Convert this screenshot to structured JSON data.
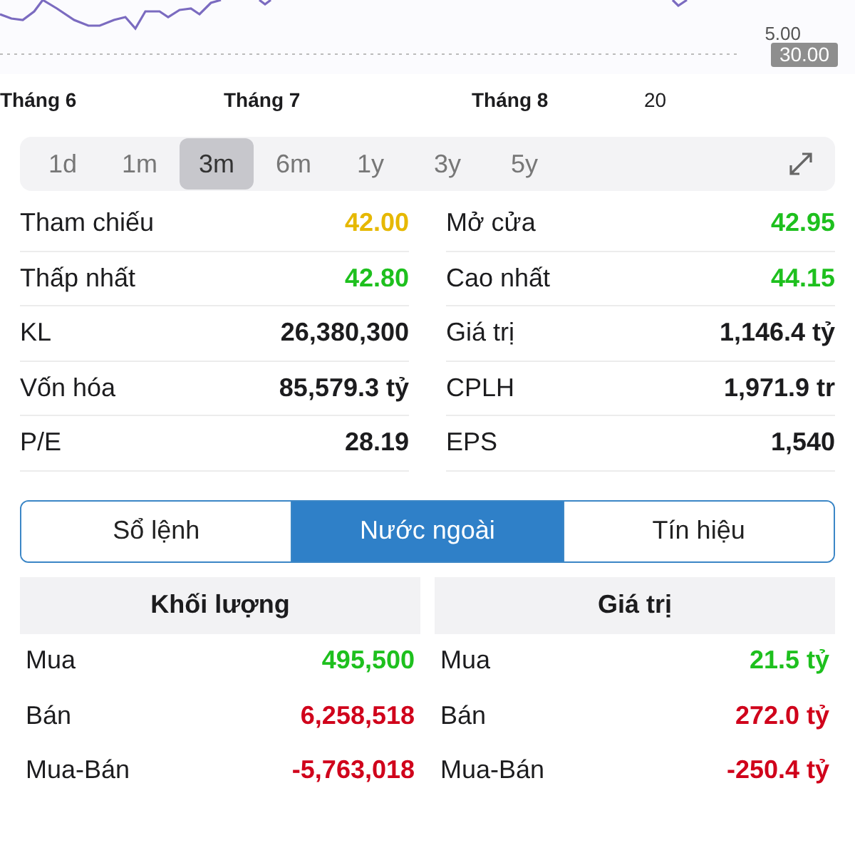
{
  "chart": {
    "price_labels": [
      "5.00"
    ],
    "price_tags": [
      "30.00"
    ],
    "x_labels": [
      "Tháng 6",
      "Tháng 7",
      "Tháng 8",
      "20"
    ]
  },
  "periods": [
    {
      "label": "1d",
      "selected": false
    },
    {
      "label": "1m",
      "selected": false
    },
    {
      "label": "3m",
      "selected": true
    },
    {
      "label": "6m",
      "selected": false
    },
    {
      "label": "1y",
      "selected": false
    },
    {
      "label": "3y",
      "selected": false
    },
    {
      "label": "5y",
      "selected": false
    }
  ],
  "stats": [
    {
      "label": "Tham chiếu",
      "value": "42.00",
      "color": "#e6b800"
    },
    {
      "label": "Mở cửa",
      "value": "42.95",
      "color": "#1ec01e"
    },
    {
      "label": "Thấp nhất",
      "value": "42.80",
      "color": "#1ec01e"
    },
    {
      "label": "Cao nhất",
      "value": "44.15",
      "color": "#1ec01e"
    },
    {
      "label": "KL",
      "value": "26,380,300",
      "color": "#1c1c1e"
    },
    {
      "label": "Giá trị",
      "value": "1,146.4 tỷ",
      "color": "#1c1c1e"
    },
    {
      "label": "Vốn hóa",
      "value": "85,579.3 tỷ",
      "color": "#1c1c1e"
    },
    {
      "label": "CPLH",
      "value": "1,971.9 tr",
      "color": "#1c1c1e"
    },
    {
      "label": "P/E",
      "value": "28.19",
      "color": "#1c1c1e"
    },
    {
      "label": "EPS",
      "value": "1,540",
      "color": "#1c1c1e"
    }
  ],
  "tabs": [
    {
      "label": "Sổ lệnh",
      "selected": false
    },
    {
      "label": "Nước ngoài",
      "selected": true
    },
    {
      "label": "Tín hiệu",
      "selected": false
    }
  ],
  "foreign": [
    {
      "heading": "Khối lượng",
      "rows": [
        {
          "label": "Mua",
          "value": "495,500",
          "color": "#1ec01e"
        },
        {
          "label": "Bán",
          "value": "6,258,518",
          "color": "#d0021b"
        },
        {
          "label": "Mua-Bán",
          "value": "-5,763,018",
          "color": "#d0021b"
        }
      ]
    },
    {
      "heading": "Giá trị",
      "rows": [
        {
          "label": "Mua",
          "value": "21.5 tỷ",
          "color": "#1ec01e"
        },
        {
          "label": "Bán",
          "value": "272.0 tỷ",
          "color": "#d0021b"
        },
        {
          "label": "Mua-Bán",
          "value": "-250.4 tỷ",
          "color": "#d0021b"
        }
      ]
    }
  ]
}
